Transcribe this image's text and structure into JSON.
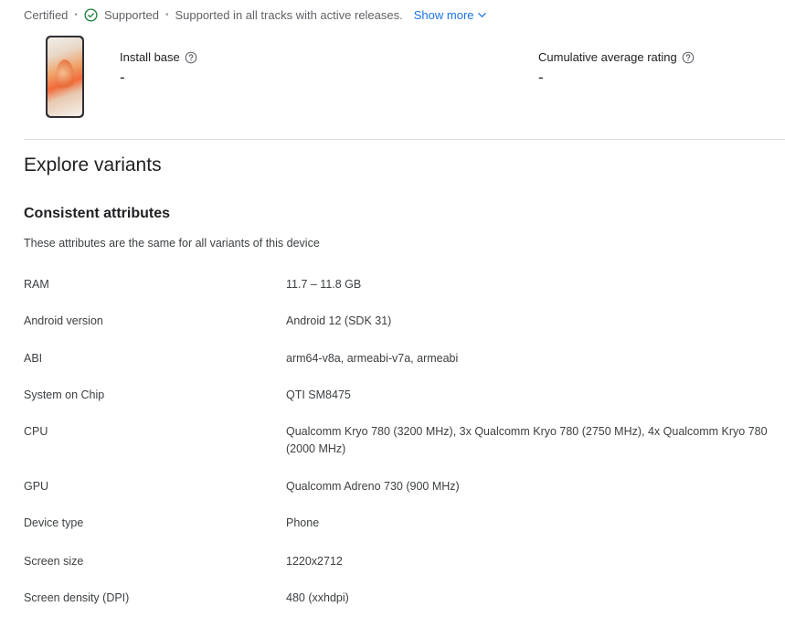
{
  "status": {
    "certified": "Certified",
    "supported": "Supported",
    "description": "Supported in all tracks with active releases.",
    "show_more": "Show more"
  },
  "icons": {
    "check": "check-circle-icon",
    "help": "help-circle-icon",
    "chevron": "chevron-down-icon"
  },
  "colors": {
    "link": "#1a73e8",
    "supported_icon": "#188038"
  },
  "metrics": {
    "install_base": {
      "label": "Install base",
      "value": "-"
    },
    "cumulative_rating": {
      "label": "Cumulative average rating",
      "value": "-"
    }
  },
  "explore": {
    "title": "Explore variants"
  },
  "consistent": {
    "title": "Consistent attributes",
    "description": "These attributes are the same for all variants of this device"
  },
  "attributes": [
    {
      "name": "RAM",
      "value": "11.7 – 11.8 GB"
    },
    {
      "name": "Android version",
      "value": "Android 12 (SDK 31)"
    },
    {
      "name": "ABI",
      "value": "arm64-v8a, armeabi-v7a, armeabi"
    },
    {
      "name": "System on Chip",
      "value": "QTI SM8475"
    },
    {
      "name": "CPU",
      "value": "Qualcomm Kryo 780 (3200 MHz), 3x Qualcomm Kryo 780 (2750 MHz), 4x Qualcomm Kryo 780 (2000 MHz)"
    },
    {
      "name": "GPU",
      "value": "Qualcomm Adreno 730 (900 MHz)"
    },
    {
      "name": "Device type",
      "value": "Phone"
    },
    {
      "name": "Screen size",
      "value": "1220x2712"
    },
    {
      "name": "Screen density (DPI)",
      "value": "480 (xxhdpi)"
    }
  ]
}
